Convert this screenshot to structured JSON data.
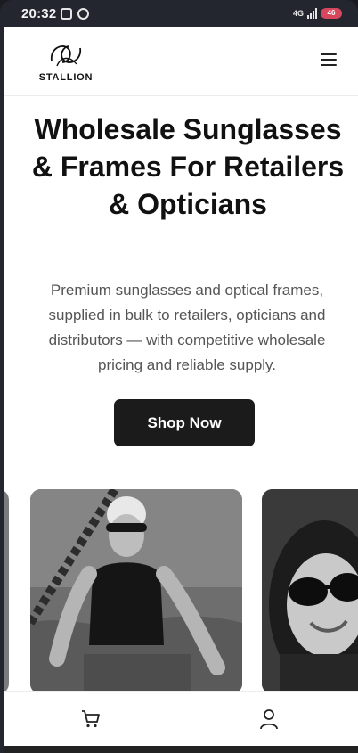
{
  "status_bar": {
    "time": "20:32",
    "network": "4G",
    "battery_level": "46"
  },
  "header": {
    "logo_text": "STALLION",
    "menu_icon": "hamburger-menu-icon"
  },
  "hero": {
    "title": "Wholesale Sunglasses & Frames For Retailers & Opticians",
    "subtitle": "Premium sunglasses and optical frames, supplied in bulk to retailers, opticians and distributors — with competitive wholesale pricing and reliable supply.",
    "cta_label": "Shop Now"
  },
  "carousel": {
    "images": [
      "swimmer-with-goggles-photo",
      "woman-in-sunglasses-photo"
    ]
  },
  "bottom_nav": {
    "cart_icon": "cart-icon",
    "account_icon": "user-icon"
  },
  "colors": {
    "accent": "#1b1b1b",
    "background": "#ffffff",
    "text": "#111111",
    "muted_text": "#555555",
    "battery": "#d6475d"
  }
}
